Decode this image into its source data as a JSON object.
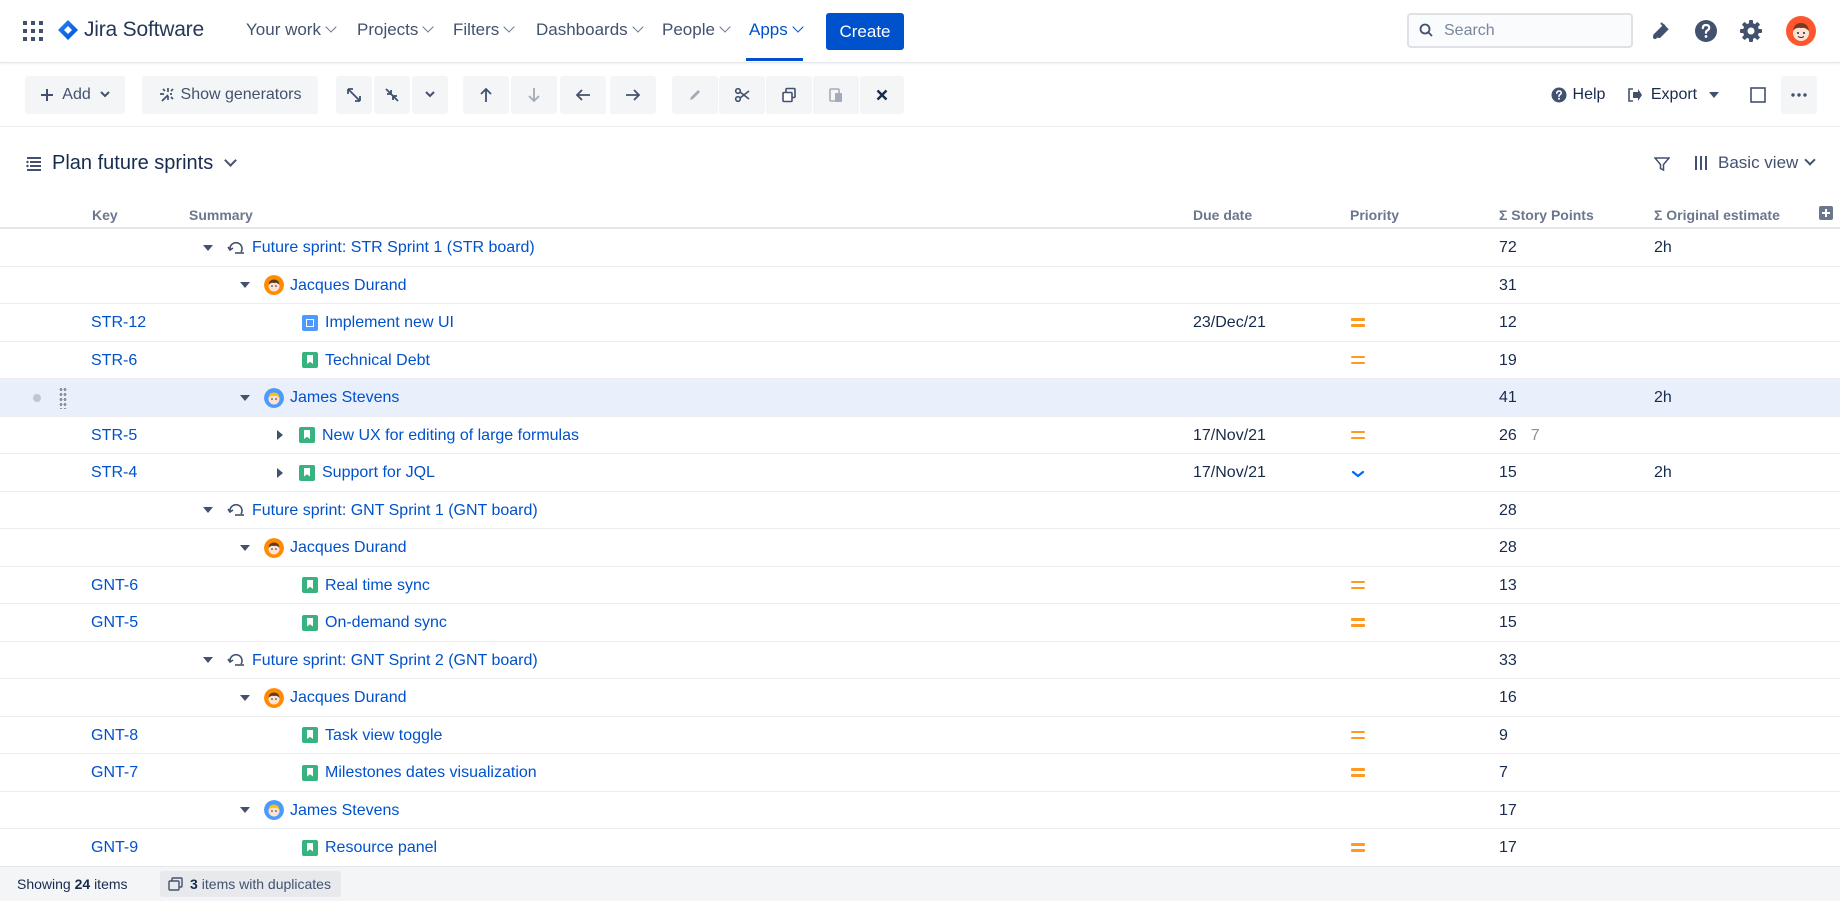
{
  "app": {
    "name": "Jira Software"
  },
  "nav": {
    "items": [
      {
        "label": "Your work"
      },
      {
        "label": "Projects"
      },
      {
        "label": "Filters"
      },
      {
        "label": "Dashboards"
      },
      {
        "label": "People"
      },
      {
        "label": "Apps"
      }
    ],
    "active": "Apps",
    "create_label": "Create",
    "search_placeholder": "Search"
  },
  "toolbar": {
    "add_label": "Add",
    "generators_label": "Show generators",
    "help_label": "Help",
    "export_label": "Export"
  },
  "plan": {
    "title": "Plan future sprints",
    "view_label": "Basic view"
  },
  "columns": {
    "key": "Key",
    "summary": "Summary",
    "due": "Due date",
    "priority": "Priority",
    "points": "Σ Story Points",
    "estimate": "Σ Original estimate"
  },
  "rows": [
    {
      "type": "sprint",
      "summary": "Future sprint: STR Sprint 1 (STR board)",
      "key": "",
      "due": "",
      "priority": "",
      "points": "72",
      "estimate": "2h"
    },
    {
      "type": "person",
      "person": "jacques",
      "summary": "Jacques Durand",
      "key": "",
      "due": "",
      "priority": "",
      "points": "31",
      "estimate": ""
    },
    {
      "type": "issue",
      "issue_type": "task",
      "summary": "Implement new UI",
      "key": "STR-12",
      "due": "23/Dec/21",
      "priority": "medium",
      "points": "12",
      "estimate": ""
    },
    {
      "type": "issue",
      "issue_type": "story",
      "summary": "Technical Debt",
      "key": "STR-6",
      "due": "",
      "priority": "medium",
      "points": "19",
      "estimate": ""
    },
    {
      "type": "person",
      "person": "james",
      "summary": "James Stevens",
      "key": "",
      "due": "",
      "priority": "",
      "points": "41",
      "estimate": "2h",
      "selected": true
    },
    {
      "type": "issue",
      "issue_type": "story",
      "expandable": true,
      "summary": "New UX for editing of large formulas",
      "key": "STR-5",
      "due": "17/Nov/21",
      "priority": "medium",
      "points": "26",
      "points_extra": "7",
      "estimate": ""
    },
    {
      "type": "issue",
      "issue_type": "story",
      "expandable": true,
      "summary": "Support for JQL",
      "key": "STR-4",
      "due": "17/Nov/21",
      "priority": "low",
      "points": "15",
      "estimate": "2h"
    },
    {
      "type": "sprint",
      "summary": "Future sprint: GNT Sprint 1 (GNT board)",
      "key": "",
      "due": "",
      "priority": "",
      "points": "28",
      "estimate": ""
    },
    {
      "type": "person",
      "person": "jacques",
      "summary": "Jacques Durand",
      "key": "",
      "due": "",
      "priority": "",
      "points": "28",
      "estimate": ""
    },
    {
      "type": "issue",
      "issue_type": "story",
      "summary": "Real time sync",
      "key": "GNT-6",
      "due": "",
      "priority": "medium",
      "points": "13",
      "estimate": ""
    },
    {
      "type": "issue",
      "issue_type": "story",
      "summary": "On-demand sync",
      "key": "GNT-5",
      "due": "",
      "priority": "medium",
      "points": "15",
      "estimate": ""
    },
    {
      "type": "sprint",
      "summary": "Future sprint: GNT Sprint 2 (GNT board)",
      "key": "",
      "due": "",
      "priority": "",
      "points": "33",
      "estimate": ""
    },
    {
      "type": "person",
      "person": "jacques",
      "summary": "Jacques Durand",
      "key": "",
      "due": "",
      "priority": "",
      "points": "16",
      "estimate": ""
    },
    {
      "type": "issue",
      "issue_type": "story",
      "summary": "Task view toggle",
      "key": "GNT-8",
      "due": "",
      "priority": "medium",
      "points": "9",
      "estimate": ""
    },
    {
      "type": "issue",
      "issue_type": "story",
      "summary": "Milestones dates visualization",
      "key": "GNT-7",
      "due": "",
      "priority": "medium",
      "points": "7",
      "estimate": ""
    },
    {
      "type": "person",
      "person": "james",
      "summary": "James Stevens",
      "key": "",
      "due": "",
      "priority": "",
      "points": "17",
      "estimate": ""
    },
    {
      "type": "issue",
      "issue_type": "story",
      "summary": "Resource panel",
      "key": "GNT-9",
      "due": "",
      "priority": "medium",
      "points": "17",
      "estimate": ""
    }
  ],
  "footer": {
    "showing_prefix": "Showing",
    "showing_count": "24",
    "showing_suffix": "items",
    "duplicates_count": "3",
    "duplicates_label": "items with duplicates"
  },
  "colors": {
    "brand": "#0052CC",
    "priority_medium": "#FF991F",
    "story": "#36B37E",
    "task": "#4C9AFF",
    "selected_row": "#E9F0FC"
  }
}
